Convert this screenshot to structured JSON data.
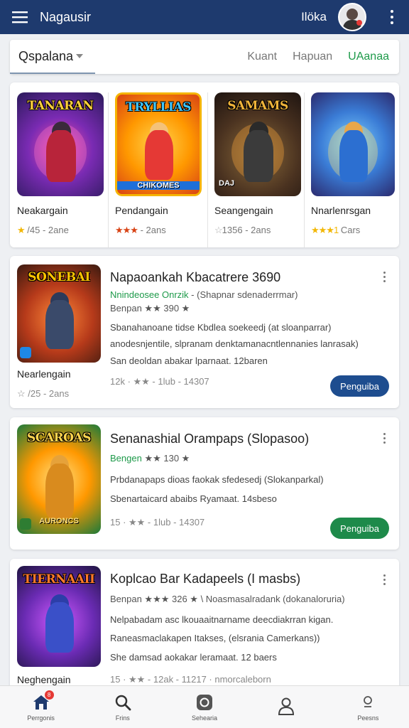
{
  "app_bar": {
    "title": "Nagausir",
    "user_name": "Ilöka",
    "icons": {
      "menu": "hamburger-menu-icon",
      "avatar": "user-avatar",
      "more": "more-vert-icon"
    },
    "color": "#1e3a6e"
  },
  "category_bar": {
    "selected": "Qspalana",
    "tabs": [
      {
        "label": "Kuant",
        "active": false
      },
      {
        "label": "Hapuan",
        "active": false
      },
      {
        "label": "UAanaa",
        "active": true
      }
    ],
    "active_color": "#1e9a4a"
  },
  "featured": [
    {
      "art_title": "TANARAN",
      "art_sub": "",
      "name": "Neakargain",
      "rating": "/45",
      "stars": "★",
      "meta": "2ane"
    },
    {
      "art_title": "TRYLLIAS",
      "art_sub": "CHIKOMES",
      "name": "Pendangain",
      "rating": "",
      "stars": "★★★",
      "meta": "2ans"
    },
    {
      "art_title": "SAMAMS",
      "art_sub": "DAJ",
      "name": "Seangengain",
      "rating": "1356",
      "stars": "☆",
      "meta": "2ans"
    },
    {
      "art_title": "",
      "art_sub": "",
      "name": "Nnarlenrsgan",
      "rating": "",
      "stars": "★★★1",
      "meta": "Cars"
    }
  ],
  "list": [
    {
      "art_title": "SONEBAI",
      "thumb_label": "Nearlengain",
      "thumb_meta": "☆ /25 - 2ans",
      "title": "Napaoankah Kbacatrere 3690",
      "line1_green": "Nnindeosee Onrzik",
      "line1_rest": " - (Shapnar sdenaderrmar)",
      "line2": "Benpan ★★ 390 ★",
      "desc1": "Sbanahanoane tidse Kbdlea soekeedj (at sloanparrar)",
      "desc2": "anodesnjentile, slpranam denktamanacntlennanies lanrasak)",
      "desc3": "San deoldan abakar lparnaat. 12baren",
      "stats": "12k · ★★ - 1lub - 14307",
      "button": "Penguiba",
      "button_color": "#1e4d8f"
    },
    {
      "art_title": "SCAROAS",
      "art_sub": "AURONCS",
      "thumb_label": "",
      "thumb_meta": "",
      "title": "Senanashial Orampaps (Slopasoo)",
      "line1_green": "Bengen",
      "line1_rest": " ★★ 130 ★",
      "line2": "",
      "desc1": "Prbdanapaps dioas faokak sfedesedj (Slokanparkal)",
      "desc2": "Sbenartaicard abaibs Ryamaat. 14sbeso",
      "desc3": "",
      "stats": "15 · ★★ - 1lub - 14307",
      "button": "Penguiba",
      "button_color": "#1e8a4a"
    },
    {
      "art_title": "TIERNAAII",
      "thumb_label": "Neghengain",
      "thumb_meta": "",
      "title": "Koplcao Bar Kadapeels (I masbs)",
      "line1_green": "",
      "line1_rest": "Benpan ★★★ 326 ★ \\ Noasmasalradank (dokanaloruria)",
      "line2": "",
      "desc1": "Nelpabadam asc lkouaaitnarname deecdiakrran kigan.",
      "desc2": "Raneasmaclakapen Itakses, (elsrania Camerkans))",
      "desc3": "She damsad aokakar leramaat. 12 baers",
      "stats": "15 · ★★ - 12ak - 11217 · nmorcaleborn",
      "button": "",
      "button_color": ""
    }
  ],
  "bottom_nav": [
    {
      "label": "Perrgonis",
      "icon": "home-icon",
      "badge": "8"
    },
    {
      "label": "Frins",
      "icon": "search-icon",
      "badge": ""
    },
    {
      "label": "Sehearia",
      "icon": "apps-icon",
      "badge": ""
    },
    {
      "label": "",
      "icon": "person-icon",
      "badge": ""
    },
    {
      "label": "Peesns",
      "icon": "profile-icon",
      "badge": ""
    }
  ]
}
